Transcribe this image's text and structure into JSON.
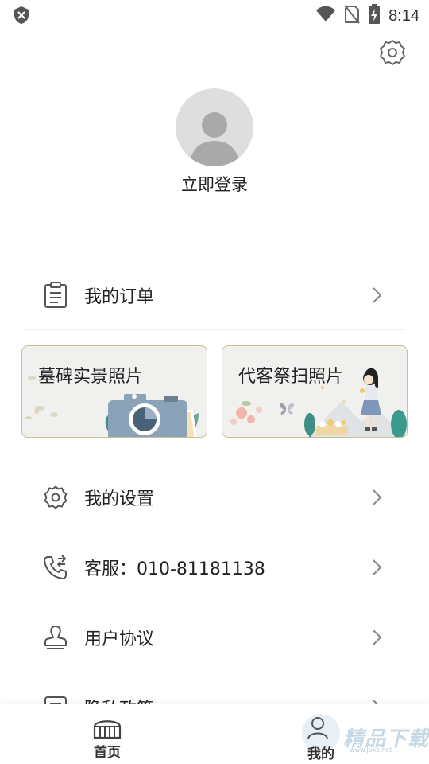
{
  "status_bar": {
    "time": "8:14",
    "icons": [
      "shield-x-icon",
      "wifi-icon",
      "no-sim-icon",
      "battery-charging-icon"
    ]
  },
  "profile": {
    "login_label": "立即登录",
    "avatar_icon": "default-avatar-icon",
    "settings_icon": "gear-icon"
  },
  "menu": {
    "orders": {
      "label": "我的订单",
      "icon": "clipboard-icon"
    },
    "settings": {
      "label": "我的设置",
      "icon": "gear-icon"
    },
    "service": {
      "label": "客服：010-81181138",
      "icon": "phone-forward-icon"
    },
    "agreement": {
      "label": "用户协议",
      "icon": "user-stamp-icon"
    },
    "privacy": {
      "label": "隐私政策",
      "icon": "document-icon"
    }
  },
  "cards": [
    {
      "title": "墓碑实景照片",
      "illustration": "camera-photos-illustration"
    },
    {
      "title": "代客祭扫照片",
      "illustration": "girl-flowers-illustration"
    }
  ],
  "bottom_nav": {
    "home_label": "首页",
    "mine_label": "我的",
    "home_icon": "home-gate-icon",
    "mine_icon": "mine-person-icon"
  },
  "watermark": {
    "text": "精品下载",
    "sub": "www.jpxz.net"
  },
  "colors": {
    "card_border": "#c8bf94",
    "icon_gray": "#555555",
    "arrow_gray": "#888888",
    "accent_teal": "#3a8f8a"
  }
}
